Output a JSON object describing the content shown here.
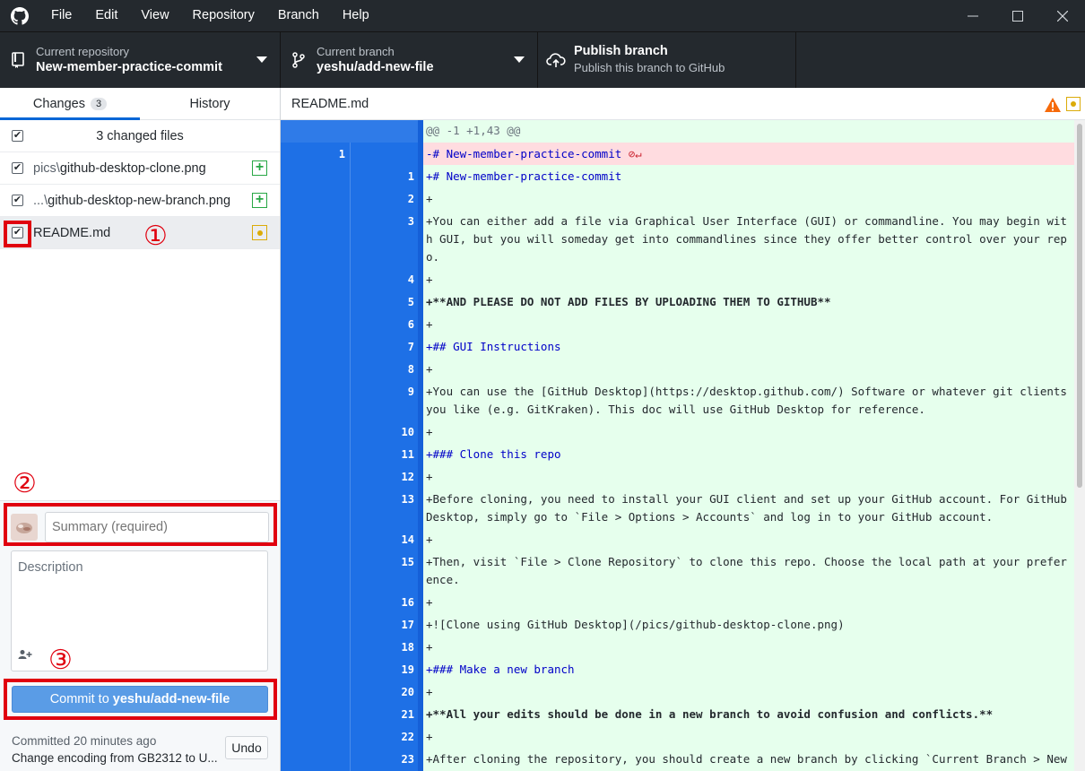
{
  "menu": [
    "File",
    "Edit",
    "View",
    "Repository",
    "Branch",
    "Help"
  ],
  "toolbar": {
    "repo_label": "Current repository",
    "repo_value": "New-member-practice-commit",
    "branch_label": "Current branch",
    "branch_value": "yeshu/add-new-file",
    "publish_label": "Publish branch",
    "publish_value": "Publish this branch to GitHub"
  },
  "sidebar": {
    "tabs": [
      {
        "label": "Changes",
        "count": "3"
      },
      {
        "label": "History"
      }
    ],
    "header": "3 changed files",
    "files": [
      {
        "dir": "pics\\",
        "name": "github-desktop-clone.png",
        "status": "added"
      },
      {
        "dir": "...\\",
        "name": "github-desktop-new-branch.png",
        "status": "added"
      },
      {
        "dir": "",
        "name": "README.md",
        "status": "modified"
      }
    ],
    "annotations": [
      "①",
      "②",
      "③"
    ]
  },
  "commit": {
    "summary_placeholder": "Summary (required)",
    "description_placeholder": "Description",
    "button_prefix": "Commit to ",
    "button_branch": "yeshu/add-new-file",
    "last_time": "Committed 20 minutes ago",
    "last_message": "Change encoding from GB2312 to U...",
    "undo": "Undo"
  },
  "diff": {
    "filename": "README.md",
    "hunk": "@@ -1 +1,43 @@",
    "deleted_line": {
      "old": "1",
      "text": "-# New-member-practice-commit"
    },
    "lines": [
      {
        "n": "1",
        "text": "+# New-member-practice-commit"
      },
      {
        "n": "2",
        "text": "+"
      },
      {
        "n": "3",
        "text": "+You can either add a file via Graphical User Interface (GUI) or commandline. You may begin with GUI, but you will someday get into commandlines since they offer better control over your repo."
      },
      {
        "n": "4",
        "text": "+"
      },
      {
        "n": "5",
        "text": "+**AND PLEASE DO NOT ADD FILES BY UPLOADING THEM TO GITHUB**"
      },
      {
        "n": "6",
        "text": "+"
      },
      {
        "n": "7",
        "text": "+## GUI Instructions"
      },
      {
        "n": "8",
        "text": "+"
      },
      {
        "n": "9",
        "text": "+You can use the [GitHub Desktop](https://desktop.github.com/) Software or whatever git clients you like (e.g. GitKraken). This doc will use GitHub Desktop for reference."
      },
      {
        "n": "10",
        "text": "+"
      },
      {
        "n": "11",
        "text": "+### Clone this repo"
      },
      {
        "n": "12",
        "text": "+"
      },
      {
        "n": "13",
        "text": "+Before cloning, you need to install your GUI client and set up your GitHub account. For GitHub Desktop, simply go to `File > Options > Accounts` and log in to your GitHub account."
      },
      {
        "n": "14",
        "text": "+"
      },
      {
        "n": "15",
        "text": "+Then, visit `File > Clone Repository` to clone this repo. Choose the local path at your preference."
      },
      {
        "n": "16",
        "text": "+"
      },
      {
        "n": "17",
        "text": "+![Clone using GitHub Desktop](/pics/github-desktop-clone.png)"
      },
      {
        "n": "18",
        "text": "+"
      },
      {
        "n": "19",
        "text": "+### Make a new branch"
      },
      {
        "n": "20",
        "text": "+"
      },
      {
        "n": "21",
        "text": "+**All your edits should be done in a new branch to avoid confusion and conflicts.**"
      },
      {
        "n": "22",
        "text": "+"
      },
      {
        "n": "23",
        "text": "+After cloning the repository, you should create a new branch by clicking `Current Branch > New"
      }
    ]
  },
  "colors": {
    "accent": "#0366d6",
    "gutter": "#1e70e6",
    "added_bg": "#e6ffed",
    "deleted_bg": "#ffdce0",
    "annotation": "#e0000f"
  }
}
